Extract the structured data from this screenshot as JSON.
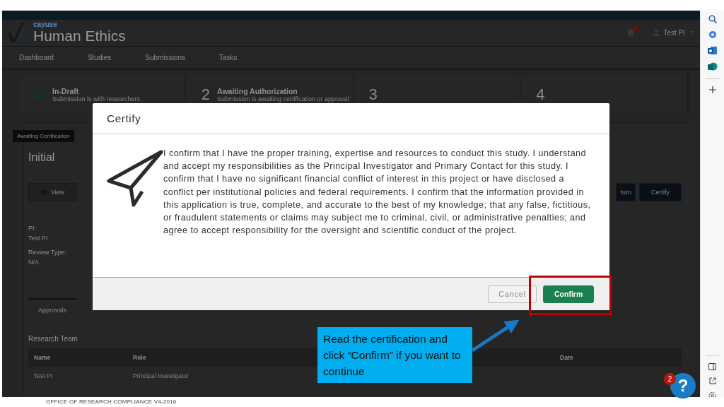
{
  "app": {
    "brand": "cayuse",
    "product": "Human Ethics",
    "user": "Test PI"
  },
  "nav": [
    "Dashboard",
    "Studies",
    "Submissions",
    "Tasks"
  ],
  "steps": [
    {
      "kind": "done",
      "label": "In-Draft",
      "detail": "Submission is with researchers"
    },
    {
      "kind": "numbered",
      "number": "2",
      "label": "Awaiting Authorization",
      "detail": "Submission is awaiting certification or approval"
    },
    {
      "kind": "numbered",
      "number": "3"
    },
    {
      "kind": "numbered",
      "number": "4"
    }
  ],
  "study": {
    "status_tag": "Awaiting Certification",
    "title": "Initial",
    "view_button": "View",
    "right_buttons": [
      "turn",
      "Certify"
    ],
    "fields": [
      {
        "label": "PI:",
        "value": "Test PI"
      },
      {
        "label": "Review Type:",
        "value": "N/A"
      }
    ],
    "tabs": [
      {
        "label": "Approvals",
        "selected": true
      }
    ],
    "team": {
      "title": "Research Team",
      "columns": [
        "Name",
        "Role",
        "Date"
      ],
      "rows": [
        {
          "name": "Test PI",
          "role": "Principal Investigator"
        }
      ]
    }
  },
  "dialog": {
    "title": "Certify",
    "text": "I confirm that I have the proper training, expertise and resources to conduct this study. I understand and accept my responsibilities as the Principal Investigator and Primary Contact for this study. I confirm that I have no significant financial conflict of interest in this project or have disclosed a conflict per institutional policies and federal requirements. I confirm that the information provided in this application is true, complete, and accurate to the best of my knowledge; that any false, fictitious, or fraudulent statements or claims may subject me to criminal, civil, or administrative penalties; and agree to accept responsibility for the oversight and scientific conduct of the project.",
    "buttons": [
      {
        "label": "Cancel",
        "kind": "secondary"
      },
      {
        "label": "Confirm",
        "kind": "primary"
      }
    ]
  },
  "callout": {
    "text": "Read the certification and click “Confirm” if you want to continue"
  },
  "help": {
    "badge": "2",
    "label": "?"
  },
  "footer": "OFFICE OF RESEARCH COMPLIANCE V4-2016"
}
